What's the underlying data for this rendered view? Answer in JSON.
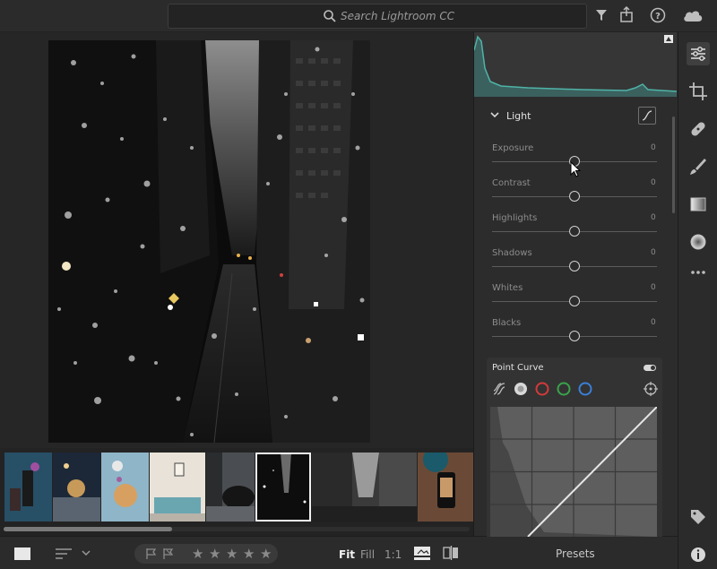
{
  "search": {
    "placeholder": "Search Lightroom CC"
  },
  "panel": {
    "section_title": "Light",
    "sliders": [
      {
        "label": "Exposure",
        "value": "0",
        "level": 0.5
      },
      {
        "label": "Contrast",
        "value": "0",
        "level": 0.5
      },
      {
        "label": "Highlights",
        "value": "0",
        "level": 0.5
      },
      {
        "label": "Shadows",
        "value": "0",
        "level": 0.5
      },
      {
        "label": "Whites",
        "value": "0",
        "level": 0.5
      },
      {
        "label": "Blacks",
        "value": "0",
        "level": 0.5
      }
    ],
    "point_curve": {
      "title": "Point Curve",
      "enabled": true
    }
  },
  "bottom": {
    "zoom": {
      "fit": "Fit",
      "fill": "Fill",
      "one": "1:1",
      "active": "fit"
    },
    "rating": 0,
    "presets_label": "Presets"
  },
  "colors": {
    "accent_teal": "#4fb3a8",
    "red_channel": "#d23a3a",
    "green_channel": "#3aa34a",
    "blue_channel": "#3a7fd9"
  }
}
